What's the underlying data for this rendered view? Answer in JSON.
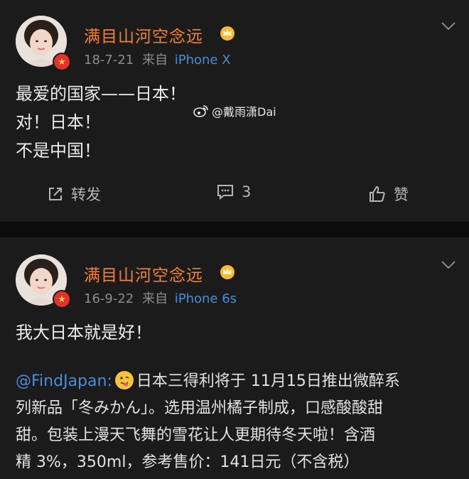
{
  "posts": [
    {
      "username": "满目山河空念远",
      "date": "18-7-21",
      "source_prefix": "来自",
      "device": "iPhone X",
      "lines": [
        "最爱的国家——日本！",
        "对！日本！",
        "不是中国！"
      ],
      "watermark": "@戴雨潇Dai",
      "actions": {
        "repost_label": "转发",
        "comment_count": "3",
        "like_label": "赞"
      }
    },
    {
      "username": "满目山河空念远",
      "date": "16-9-22",
      "source_prefix": "来自",
      "device": "iPhone 6s",
      "lines": [
        "我大日本就是好！"
      ],
      "mention": "@FindJapan:",
      "shared_lines": [
        "日本三得利将于 11月15日推出微醉系",
        "列新品「冬みかん」。选用温州橘子制成，口感酸酸甜",
        "甜。包装上漫天飞舞的雪花让人更期待冬天啦！含酒",
        "精 3%，350ml，参考售价：141日元（不含税）"
      ]
    }
  ],
  "colors": {
    "username": "#f0823a",
    "link": "#4a8ed6",
    "meta": "#8c8c8c",
    "text": "#ececec",
    "card_bg": "#1b1b1b",
    "page_bg": "#0c0c0c"
  }
}
